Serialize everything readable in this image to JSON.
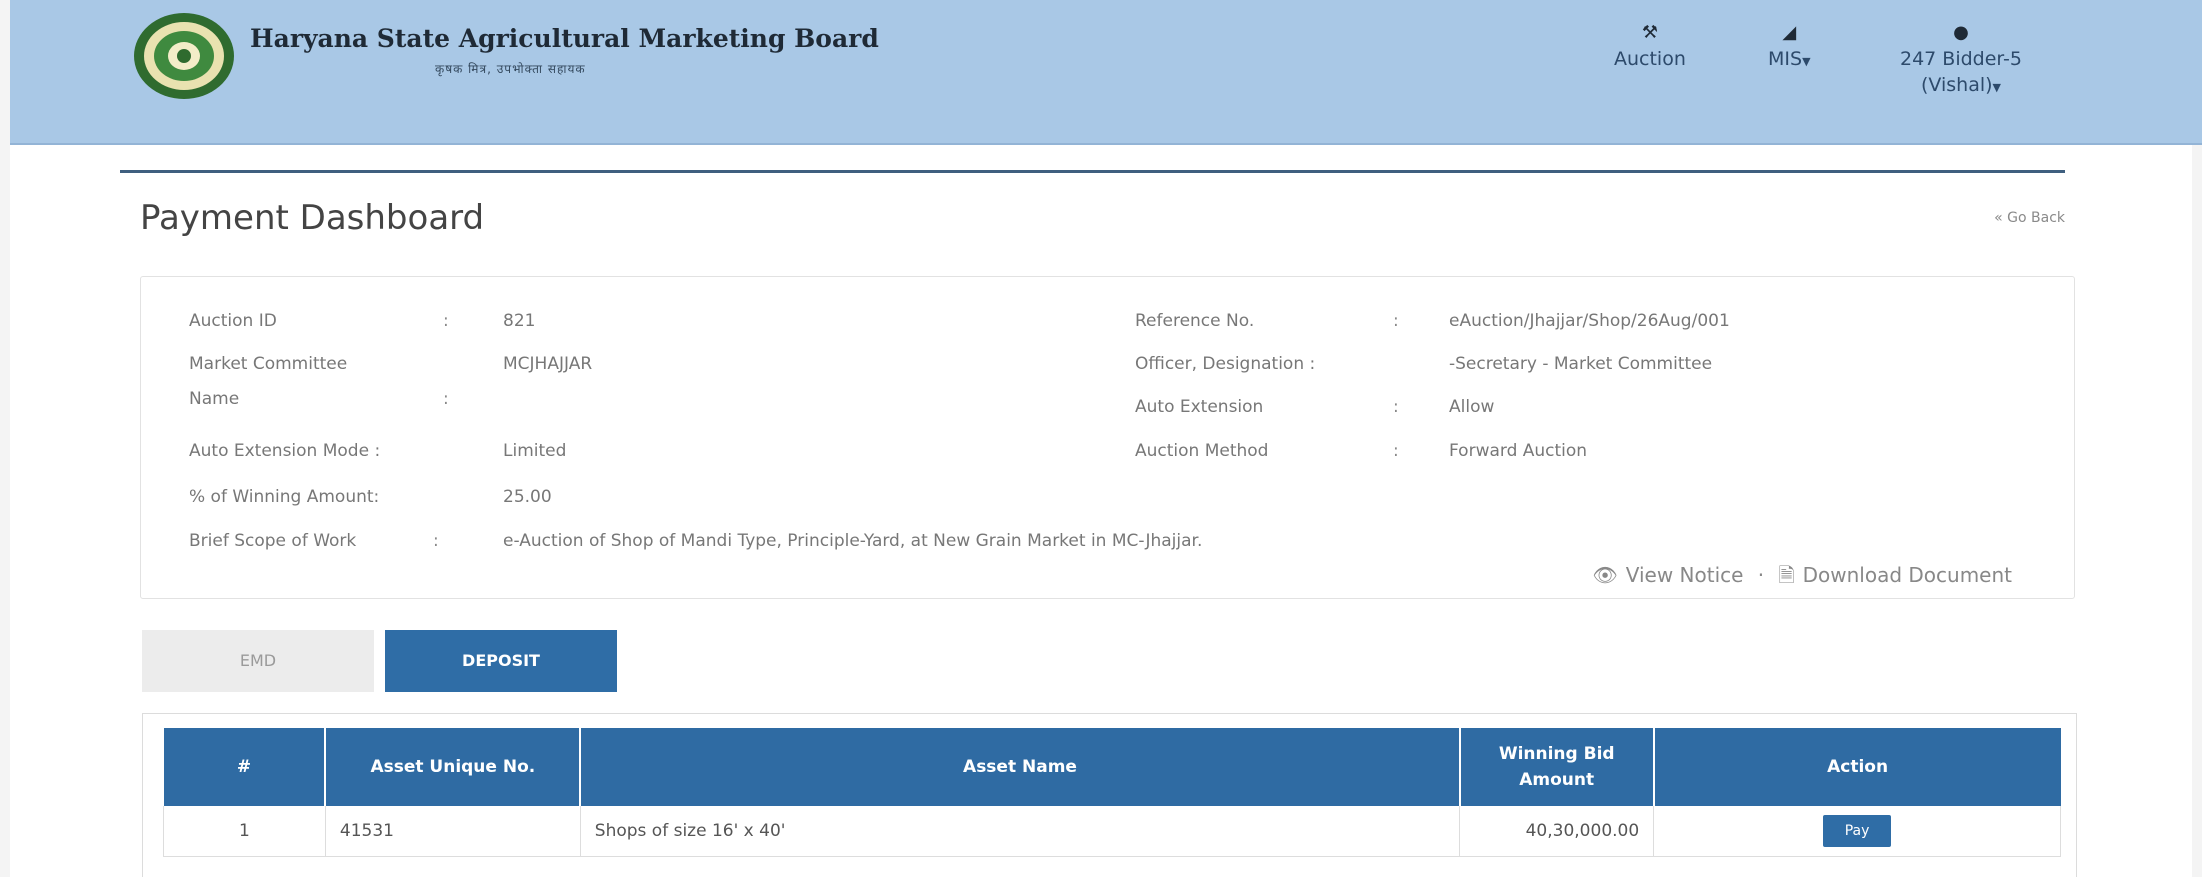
{
  "header": {
    "title": "Haryana State Agricultural Marketing Board",
    "subtitle": "कृषक मित्र, उपभोक्ता सहायक",
    "nav": {
      "auction": "Auction",
      "mis": "MIS",
      "user_line1": "247 Bidder-5",
      "user_line2": "(Vishal)"
    }
  },
  "page": {
    "title": "Payment Dashboard",
    "go_back": "« Go Back"
  },
  "details": {
    "auction_id_label": "Auction ID",
    "auction_id": "821",
    "market_committee_label_1": "Market Committee",
    "market_committee_label_2": "Name",
    "market_committee": "MCJHAJJAR",
    "auto_ext_mode_label": "Auto Extension Mode :",
    "auto_ext_mode": "Limited",
    "winning_pct_label": "% of Winning Amount:",
    "winning_pct": "25.00",
    "scope_label": "Brief Scope of Work",
    "scope": "e-Auction of Shop of Mandi Type, Principle-Yard, at New Grain Market in MC-Jhajjar.",
    "reference_label": "Reference No.",
    "reference": "eAuction/Jhajjar/Shop/26Aug/001",
    "officer_label": "Officer, Designation :",
    "officer": "-Secretary - Market Committee",
    "auto_ext_label": "Auto Extension",
    "auto_ext": "Allow",
    "method_label": "Auction Method",
    "method": "Forward Auction",
    "view_notice": "View Notice",
    "download": "Download Document"
  },
  "tabs": {
    "emd": "EMD",
    "deposit": "DEPOSIT"
  },
  "table": {
    "headers": {
      "num": "#",
      "asset_no": "Asset Unique No.",
      "asset_name": "Asset Name",
      "amount_1": "Winning Bid",
      "amount_2": "Amount",
      "action": "Action"
    },
    "rows": [
      {
        "num": "1",
        "asset_no": "41531",
        "asset_name": "Shops of size 16' x 40'",
        "amount": "40,30,000.00",
        "action": "Pay"
      }
    ]
  },
  "colors": {
    "header_bg": "#a9c8e6",
    "accent": "#2f6da6",
    "table_header": "#2f6ba3"
  }
}
